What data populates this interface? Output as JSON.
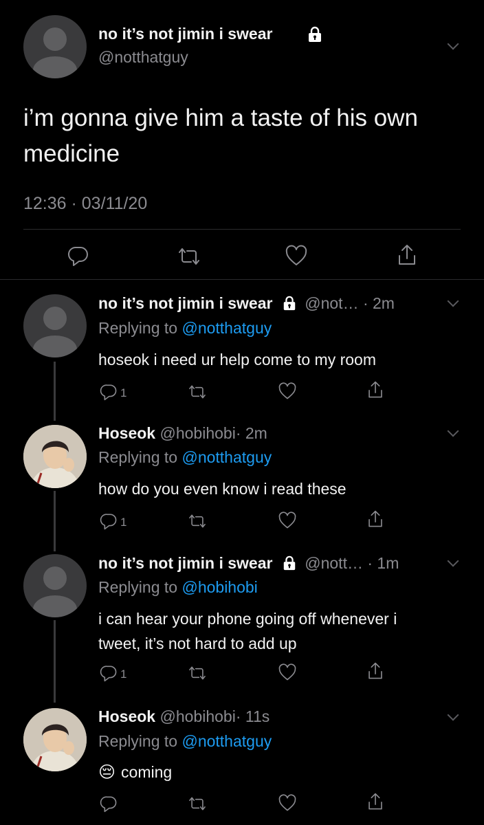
{
  "main_tweet": {
    "name": "no it’s not jimin i swear",
    "handle": "@notthatguy",
    "text_line1": "i’m gonna give him a taste of his own",
    "text_line2": "medicine",
    "timestamp": "12:36 · 03/11/20"
  },
  "replies": [
    {
      "name": "no it’s not jimin i swear",
      "handle": "@not…",
      "time": "· 2m",
      "replying_label": "Replying to ",
      "replying_to": "@notthatguy",
      "text_line1": "hoseok i need ur help come to my room",
      "text_line2": "",
      "reply_count": "1"
    },
    {
      "name": "Hoseok",
      "handle": "@hobihobi",
      "time": "· 2m",
      "replying_label": "Replying to ",
      "replying_to": "@notthatguy",
      "text_line1": "how do you even know i read these",
      "text_line2": "",
      "reply_count": "1"
    },
    {
      "name": "no it’s not jimin i swear",
      "handle": "@nott…",
      "time": "· 1m",
      "replying_label": "Replying to ",
      "replying_to": "@hobihobi",
      "text_line1": "i can hear your phone going off whenever i",
      "text_line2": "tweet, it’s not hard to add up",
      "reply_count": "1"
    },
    {
      "name": "Hoseok",
      "handle": "@hobihobi",
      "time": "· 11s",
      "replying_label": "Replying to ",
      "replying_to": "@notthatguy",
      "text_line1": "coming",
      "text_line2": "",
      "emoji": "😔",
      "reply_count": ""
    }
  ],
  "icons": [
    "lock-icon",
    "chevron-down-icon",
    "reply-icon",
    "retweet-icon",
    "like-icon",
    "share-icon"
  ],
  "colors": {
    "background": "#000000",
    "link": "#1d9bf0",
    "muted": "#8b8b90"
  }
}
